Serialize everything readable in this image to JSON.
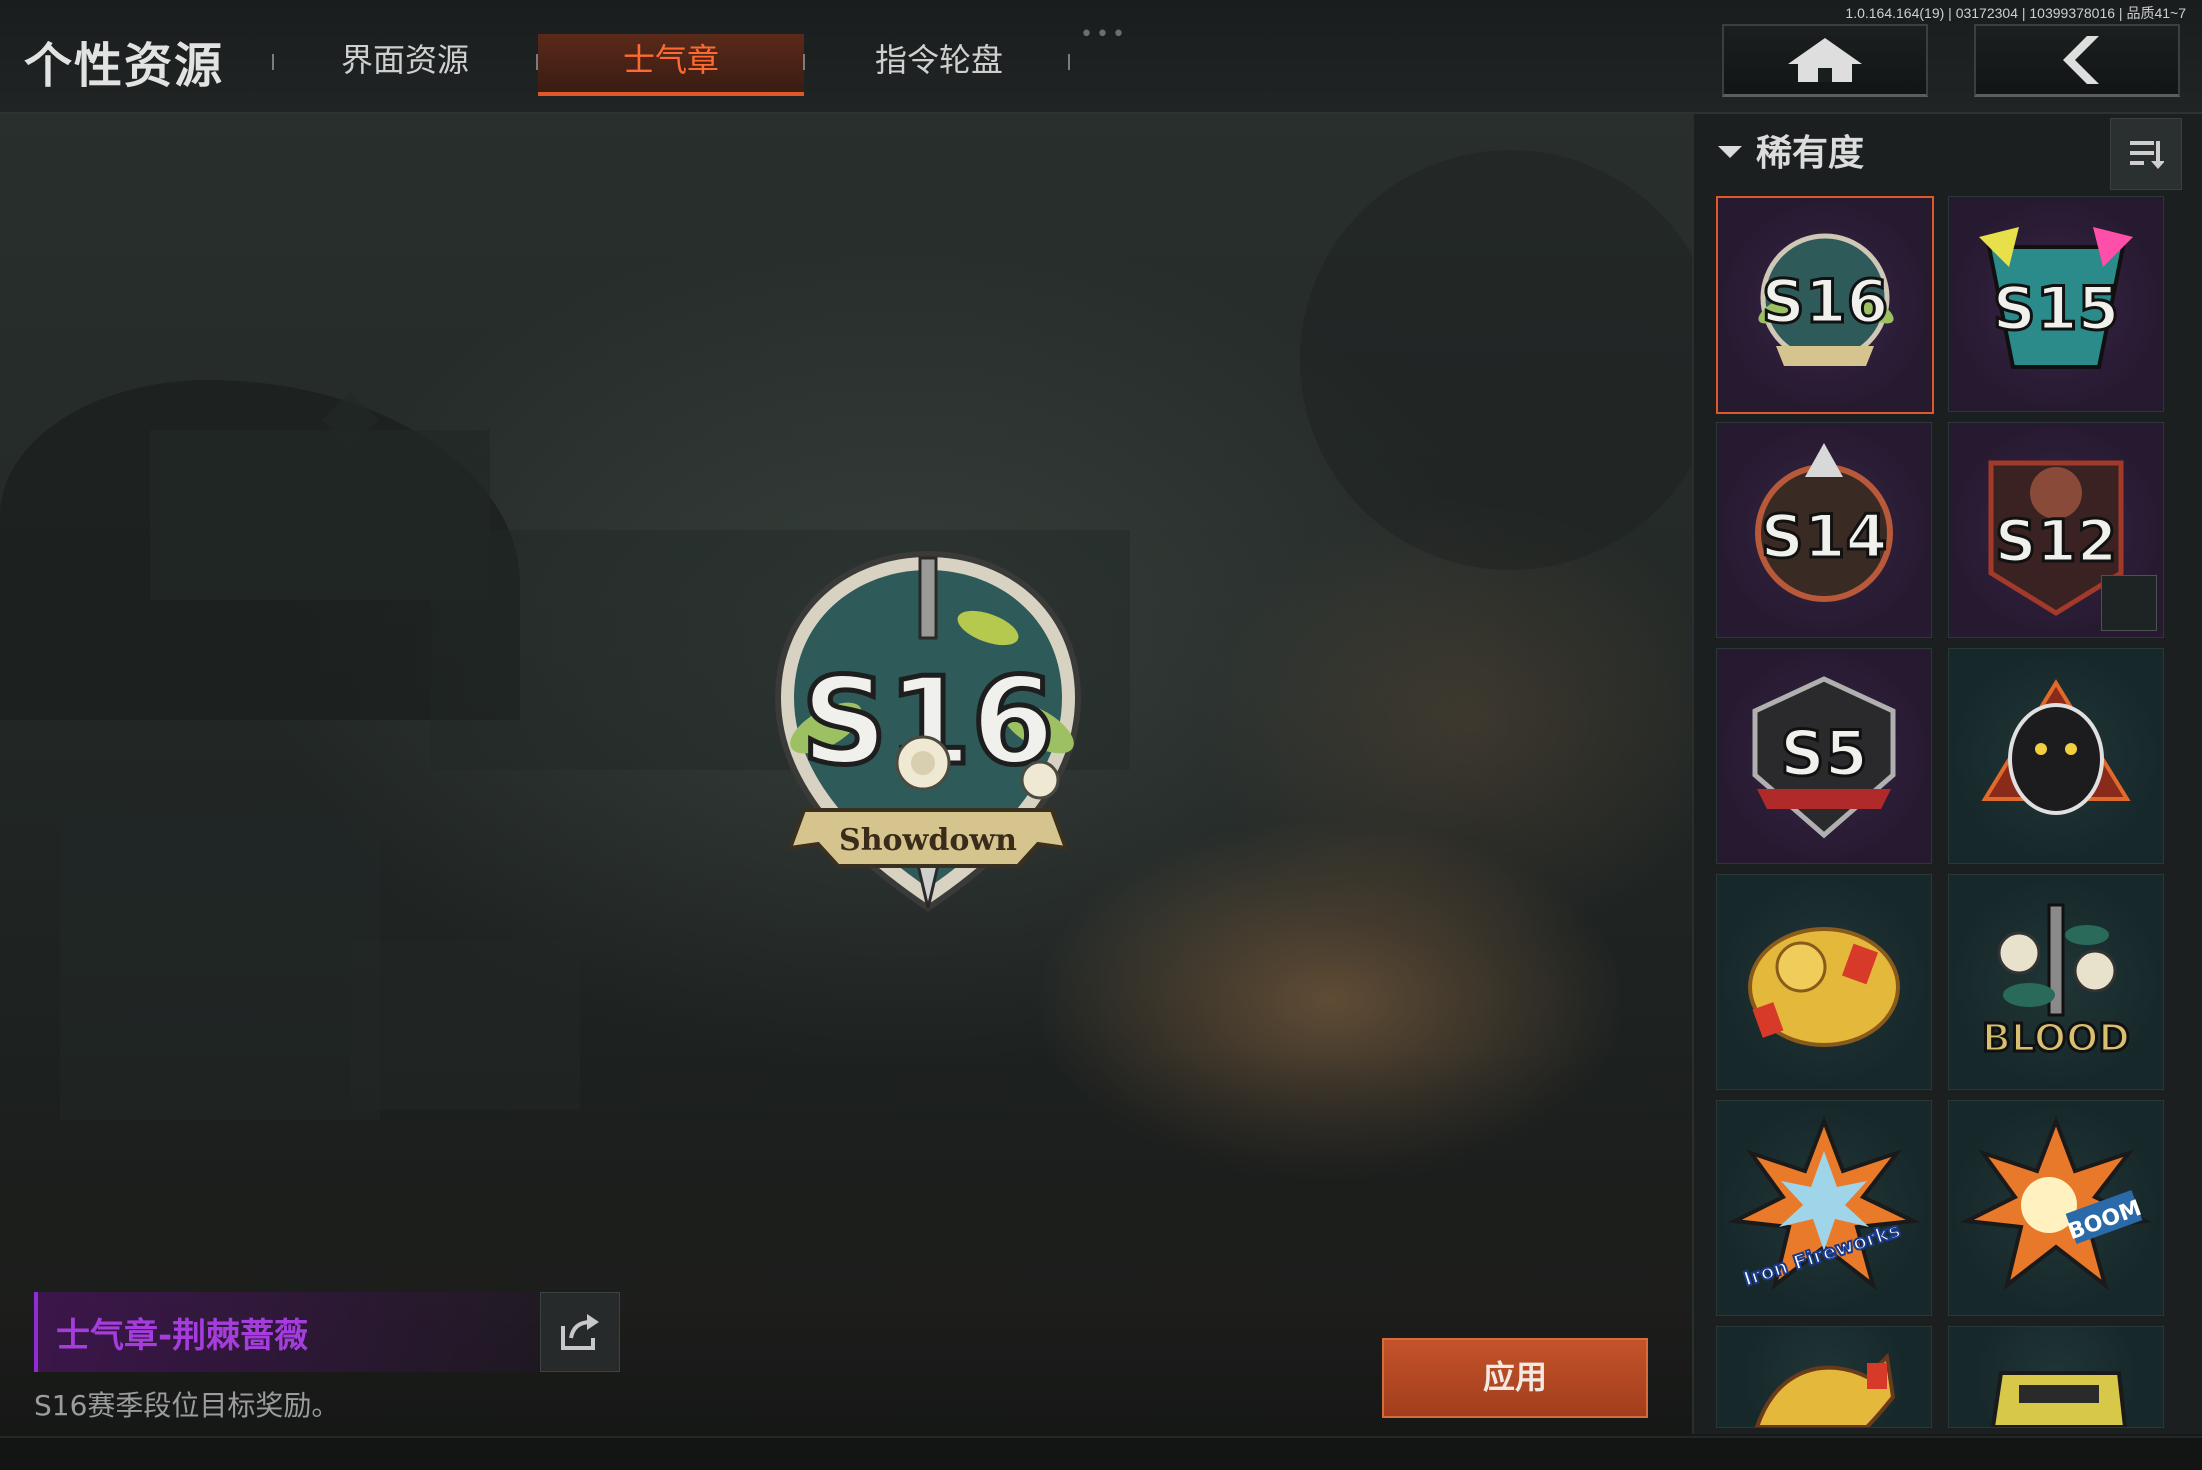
{
  "header": {
    "title": "个性资源",
    "tabs": [
      {
        "label": "界面资源",
        "active": false
      },
      {
        "label": "士气章",
        "active": true
      },
      {
        "label": "指令轮盘",
        "active": false
      }
    ],
    "more_dots": "•••",
    "version": "1.0.164.164(19) | 03172304 | 10399378016 | 品质41~7",
    "home_icon": "home-icon",
    "back_icon": "back-chevron-icon"
  },
  "preview": {
    "badge_text": "S16",
    "ribbon_text": "Showdown"
  },
  "item": {
    "name": "士气章-荆棘蔷薇",
    "description": "S16赛季段位目标奖励。",
    "share_icon": "share-icon",
    "apply_label": "应用"
  },
  "panel": {
    "filter_label": "稀有度",
    "sort_icon": "sort-icon",
    "items": [
      {
        "label": "S16",
        "rarity": "purple",
        "selected": true
      },
      {
        "label": "S15",
        "rarity": "purple",
        "selected": false
      },
      {
        "label": "S14",
        "rarity": "purple",
        "selected": false
      },
      {
        "label": "S12",
        "rarity": "purple",
        "selected": false
      },
      {
        "label": "S5",
        "rarity": "purple",
        "selected": false
      },
      {
        "label": "",
        "rarity": "teal",
        "selected": false
      },
      {
        "label": "",
        "rarity": "teal",
        "selected": false
      },
      {
        "label": "BLOOD",
        "rarity": "teal",
        "selected": false
      },
      {
        "label": "Iron Fireworks",
        "rarity": "teal",
        "selected": false
      },
      {
        "label": "BOOM",
        "rarity": "teal",
        "selected": false
      },
      {
        "label": "",
        "rarity": "teal",
        "selected": false
      },
      {
        "label": "",
        "rarity": "teal",
        "selected": false
      }
    ]
  },
  "colors": {
    "accent": "#e0582a",
    "active_tab_text": "#ff6a32",
    "item_name": "#a43ddc",
    "purple_rarity": "#3a2448",
    "teal_rarity": "#203537"
  }
}
